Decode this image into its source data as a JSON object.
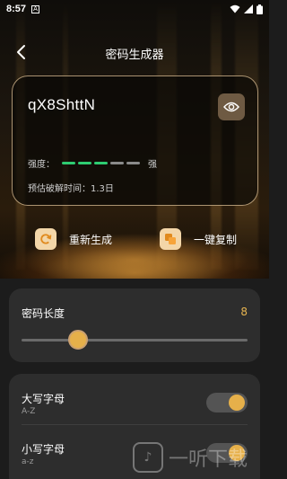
{
  "status_bar": {
    "time": "8:57",
    "notification_glyph": "A"
  },
  "header": {
    "title": "密码生成器"
  },
  "card": {
    "password": "qX8ShttN",
    "strength_label": "强度：",
    "strength_level": "强",
    "strength_segments_filled": 3,
    "strength_segments_total": 5,
    "crack_time": "预估破解时间：1.3日"
  },
  "actions": {
    "regenerate": "重新生成",
    "copy": "一键复制"
  },
  "length": {
    "label": "密码长度",
    "value": "8",
    "fraction": 0.25
  },
  "options": [
    {
      "name": "大写字母",
      "sub": "A-Z",
      "enabled": true
    },
    {
      "name": "小写字母",
      "sub": "a-z",
      "enabled": true
    }
  ],
  "colors": {
    "accent": "#e6b04a",
    "strength_on": "#2ecc71",
    "strength_off": "#8a8a8a",
    "card_border": "#f0d7b0"
  },
  "watermark": {
    "text": "一听下载"
  }
}
